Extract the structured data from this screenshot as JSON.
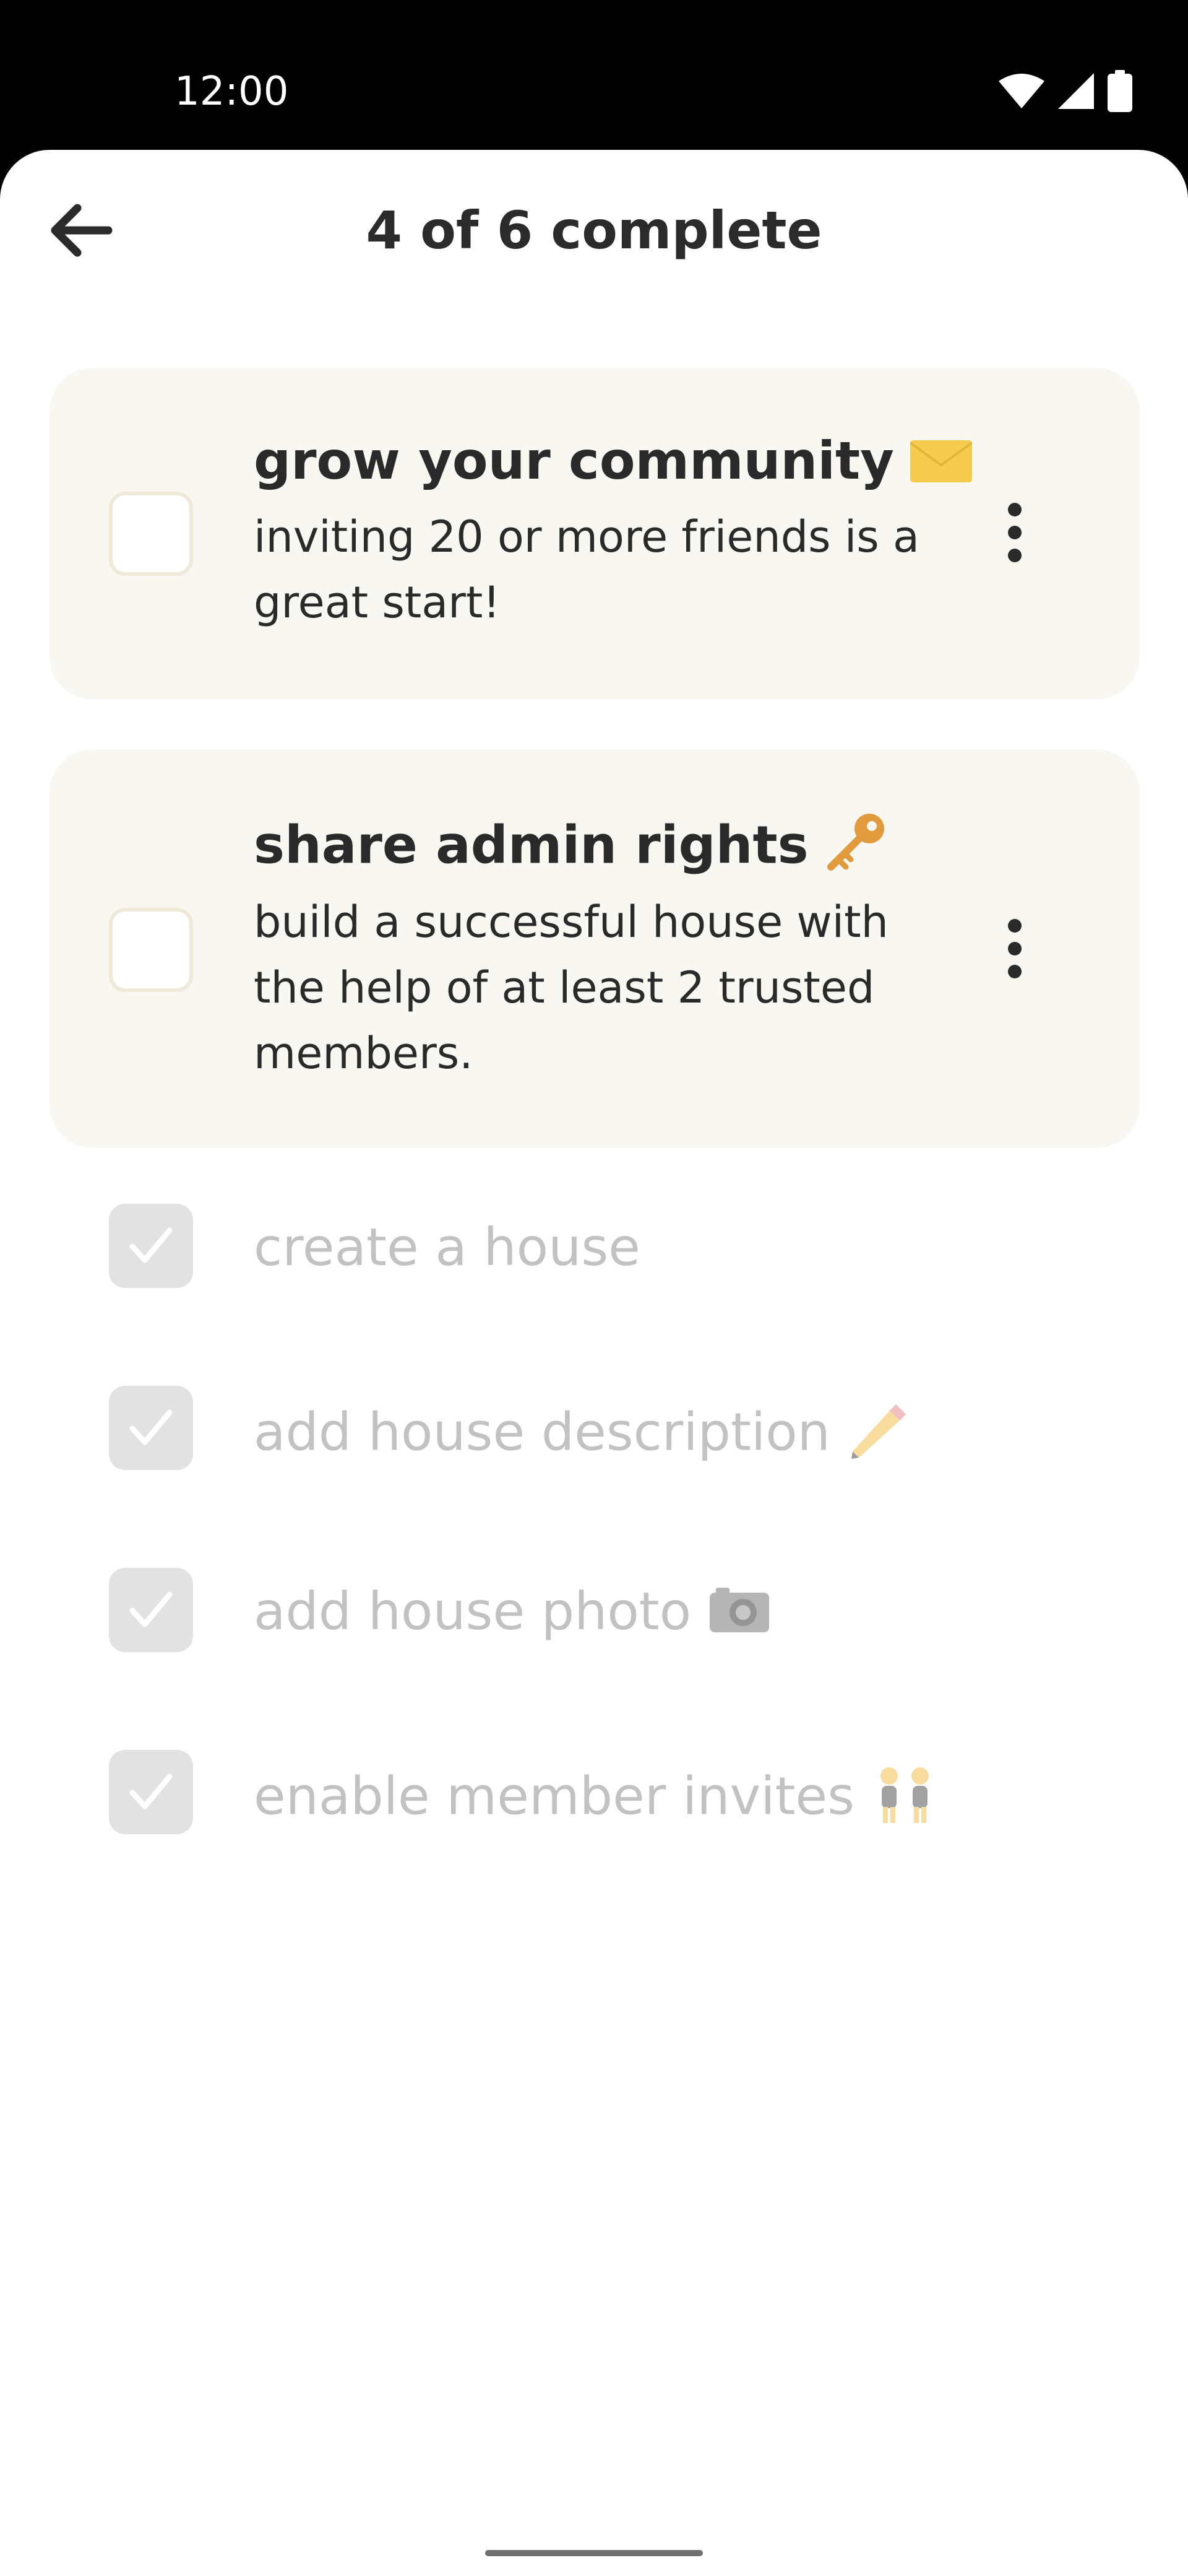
{
  "status_bar": {
    "time": "12:00",
    "icons": [
      "wifi-icon",
      "cellular-signal-icon",
      "battery-icon"
    ]
  },
  "header": {
    "back_icon": "arrow-left-icon",
    "title": "4 of 6 complete"
  },
  "pending_tasks": [
    {
      "title": "grow your community",
      "emoji": "envelope-emoji",
      "description": "inviting 20 or more friends is a great start!",
      "more_icon": "more-vertical-icon"
    },
    {
      "title": "share admin rights",
      "emoji": "key-emoji",
      "description": "build a successful house with the help of at least 2 trusted members.",
      "more_icon": "more-vertical-icon"
    }
  ],
  "completed_tasks": [
    {
      "label": "create a house",
      "emoji": ""
    },
    {
      "label": "add house description",
      "emoji": "pencil-emoji"
    },
    {
      "label": "add house photo",
      "emoji": "camera-emoji"
    },
    {
      "label": "enable member invites",
      "emoji": "people-emoji"
    }
  ],
  "colors": {
    "card_background": "#f9f7f1",
    "checkbox_border": "#efe9da",
    "completed_check": "#e2e2e2",
    "completed_text": "#c2c2c2",
    "primary_text": "#2a2a2a"
  }
}
